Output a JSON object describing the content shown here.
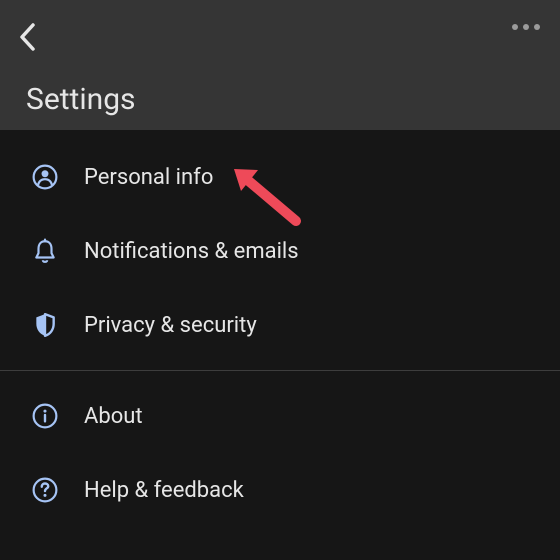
{
  "header": {
    "title": "Settings"
  },
  "menu": {
    "items": [
      {
        "label": "Personal info"
      },
      {
        "label": "Notifications & emails"
      },
      {
        "label": "Privacy & security"
      }
    ],
    "secondary": [
      {
        "label": "About"
      },
      {
        "label": "Help & feedback"
      }
    ]
  },
  "colors": {
    "icon": "#a6c4f5",
    "text": "#e6e6e6",
    "arrow": "#ee4a59"
  }
}
